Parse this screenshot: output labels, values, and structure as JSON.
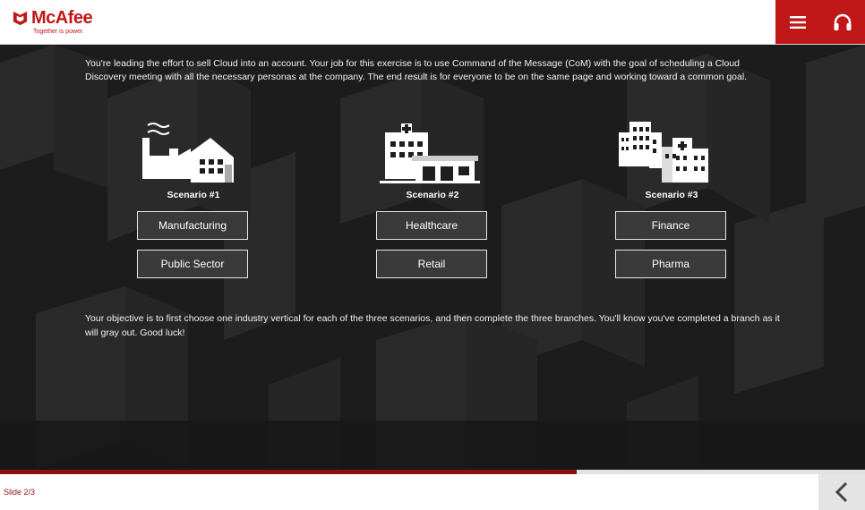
{
  "brand": {
    "name": "McAfee",
    "tagline": "Together is power.",
    "color": "#c01818",
    "dark_red": "#8b1010"
  },
  "header": {
    "menu_icon": "hamburger-menu-icon",
    "audio_icon": "headphones-icon"
  },
  "intro_text": "You're leading the effort to sell Cloud into an account. Your job for this exercise is to use Command of the Message (CoM) with the goal of scheduling a Cloud Discovery meeting with all the necessary personas at the company. The end result is for everyone to be on the same page and working toward a common goal.",
  "scenarios": [
    {
      "title": "Scenario #1",
      "icon": "factory-icon",
      "options": [
        "Manufacturing",
        "Public Sector"
      ]
    },
    {
      "title": "Scenario #2",
      "icon": "hospital-icon",
      "options": [
        "Healthcare",
        "Retail"
      ]
    },
    {
      "title": "Scenario #3",
      "icon": "city-buildings-icon",
      "options": [
        "Finance",
        "Pharma"
      ]
    }
  ],
  "objective_text": "Your objective is to first choose one industry vertical for each of the three scenarios, and then complete the three branches. You'll know you've completed a branch as it will gray out. Good luck!",
  "footer": {
    "slide_label": "Slide 2/3",
    "progress_fraction": 0.667,
    "back_icon": "chevron-left-icon"
  }
}
